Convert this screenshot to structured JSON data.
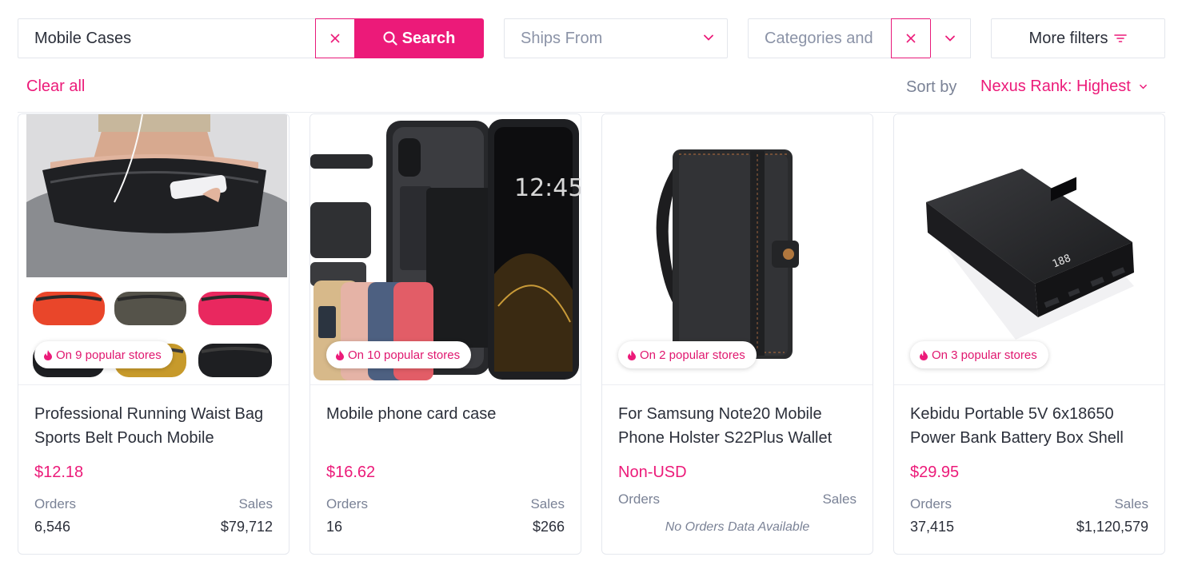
{
  "search": {
    "value": "Mobile Cases",
    "button_label": "Search"
  },
  "filters": {
    "ships_from_placeholder": "Ships From",
    "categories_placeholder": "Categories and",
    "more_filters_label": "More filters"
  },
  "toolbar": {
    "clear_all_label": "Clear all",
    "sort_label": "Sort by",
    "sort_value": "Nexus Rank: Highest"
  },
  "colors": {
    "accent": "#ec1a79",
    "muted": "#7a8296",
    "text": "#2b2f3a",
    "border": "#e5e8ee"
  },
  "icons": [
    "search-icon",
    "close-icon",
    "chevron-down-icon",
    "filter-lines-icon",
    "flame-icon"
  ],
  "products": [
    {
      "image": "waist-bag-photo",
      "badge": "On 9 popular stores",
      "title": "Professional Running Waist Bag Sports Belt Pouch Mobile",
      "price": "$12.18",
      "orders_label": "Orders",
      "sales_label": "Sales",
      "orders": "6,546",
      "sales": "$79,712"
    },
    {
      "image": "phone-card-case-photo",
      "badge": "On 10 popular stores",
      "title": "Mobile phone card case",
      "price": "$16.62",
      "orders_label": "Orders",
      "sales_label": "Sales",
      "orders": "16",
      "sales": "$266"
    },
    {
      "image": "wallet-holster-photo",
      "badge": "On 2 popular stores",
      "title": "For Samsung Note20 Mobile Phone Holster S22Plus Wallet",
      "price": "Non-USD",
      "orders_label": "Orders",
      "sales_label": "Sales",
      "no_data": "No Orders Data Available"
    },
    {
      "image": "power-bank-photo",
      "badge": "On 3 popular stores",
      "title": "Kebidu Portable 5V 6x18650 Power Bank Battery Box Shell",
      "price": "$29.95",
      "orders_label": "Orders",
      "sales_label": "Sales",
      "orders": "37,415",
      "sales": "$1,120,579"
    }
  ]
}
